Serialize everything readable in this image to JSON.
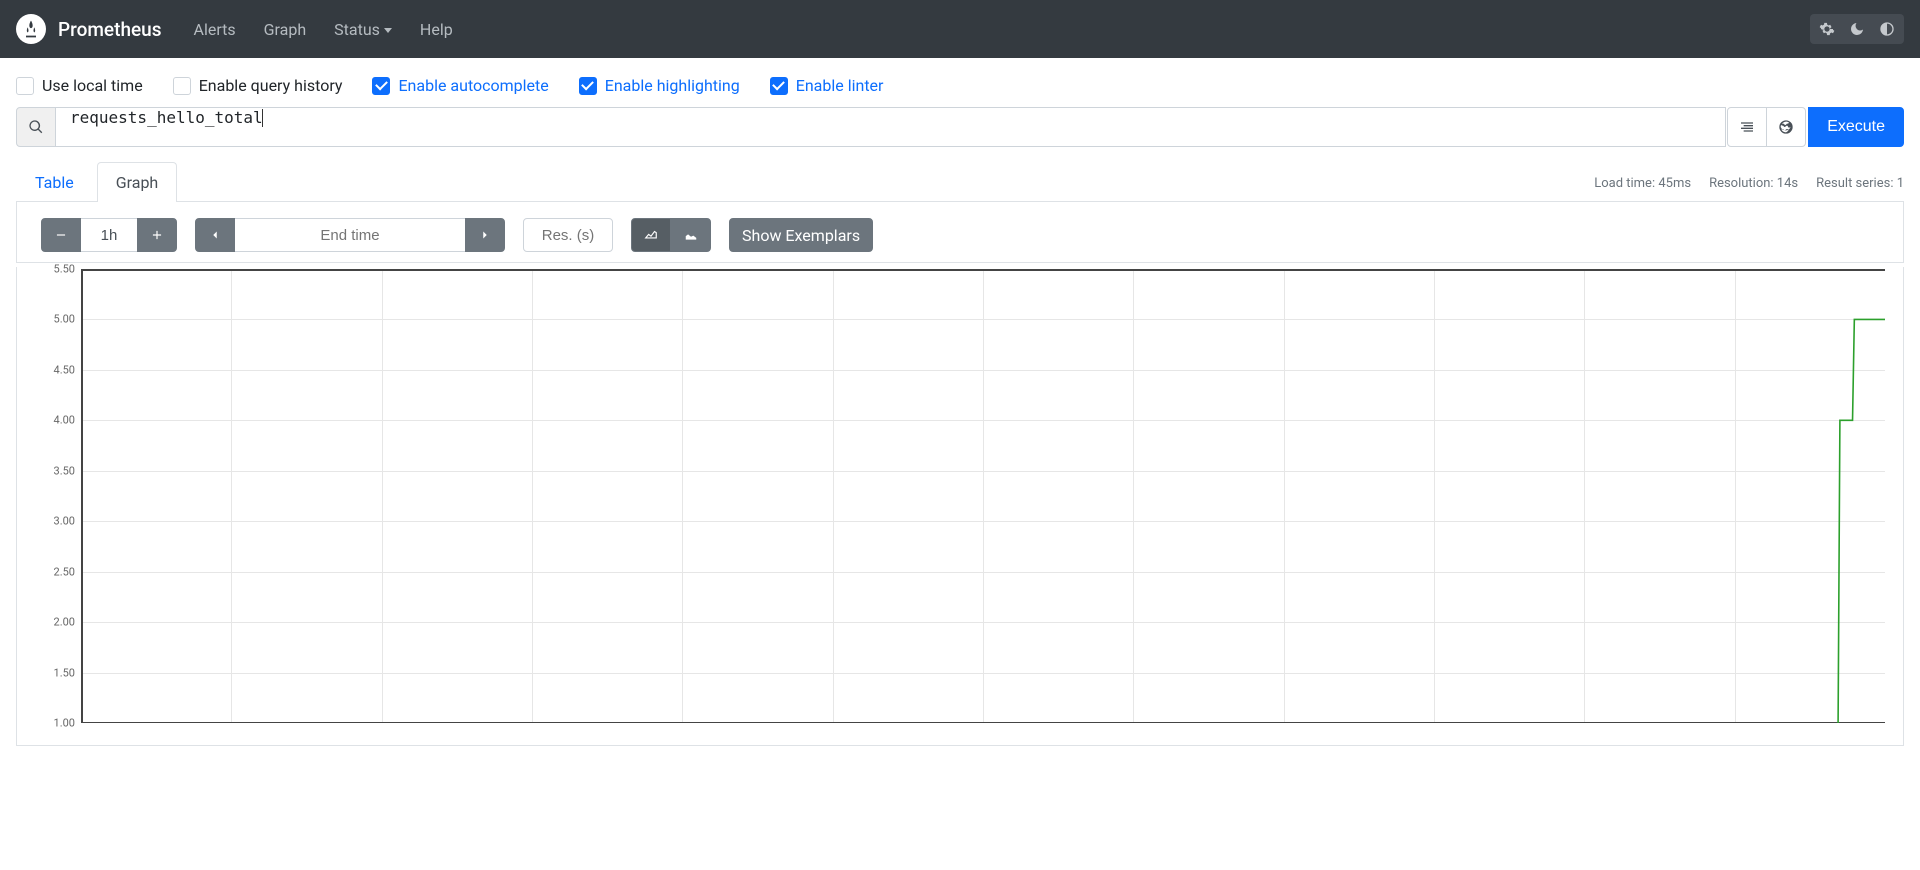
{
  "brand": "Prometheus",
  "nav": {
    "links": [
      "Alerts",
      "Graph",
      "Status",
      "Help"
    ],
    "status_has_dropdown": true
  },
  "options": [
    {
      "key": "use_local_time",
      "label": "Use local time",
      "checked": false,
      "blue": false
    },
    {
      "key": "query_history",
      "label": "Enable query history",
      "checked": false,
      "blue": false
    },
    {
      "key": "autocomplete",
      "label": "Enable autocomplete",
      "checked": true,
      "blue": true
    },
    {
      "key": "highlighting",
      "label": "Enable highlighting",
      "checked": true,
      "blue": true
    },
    {
      "key": "linter",
      "label": "Enable linter",
      "checked": true,
      "blue": true
    }
  ],
  "query": {
    "expression": "requests_hello_total",
    "execute_label": "Execute"
  },
  "tabs": {
    "items": [
      "Table",
      "Graph"
    ],
    "active_index": 1
  },
  "meta": {
    "load_time": "Load time: 45ms",
    "resolution": "Resolution: 14s",
    "result_series": "Result series: 1"
  },
  "controls": {
    "range": "1h",
    "end_time_placeholder": "End time",
    "res_placeholder": "Res. (s)",
    "show_exemplars_label": "Show Exemplars"
  },
  "chart_data": {
    "type": "line",
    "ylim": [
      1.0,
      5.5
    ],
    "yticks": [
      5.5,
      5.0,
      4.5,
      4.0,
      3.5,
      3.0,
      2.5,
      2.0,
      1.5,
      1.0
    ],
    "x_grid_columns": 12,
    "series": [
      {
        "name": "requests_hello_total",
        "color": "#2ca02c",
        "points": [
          {
            "x": 0.974,
            "y": 1.0
          },
          {
            "x": 0.975,
            "y": 4.0
          },
          {
            "x": 0.982,
            "y": 4.0
          },
          {
            "x": 0.983,
            "y": 5.0
          },
          {
            "x": 1.0,
            "y": 5.0
          }
        ]
      }
    ]
  }
}
